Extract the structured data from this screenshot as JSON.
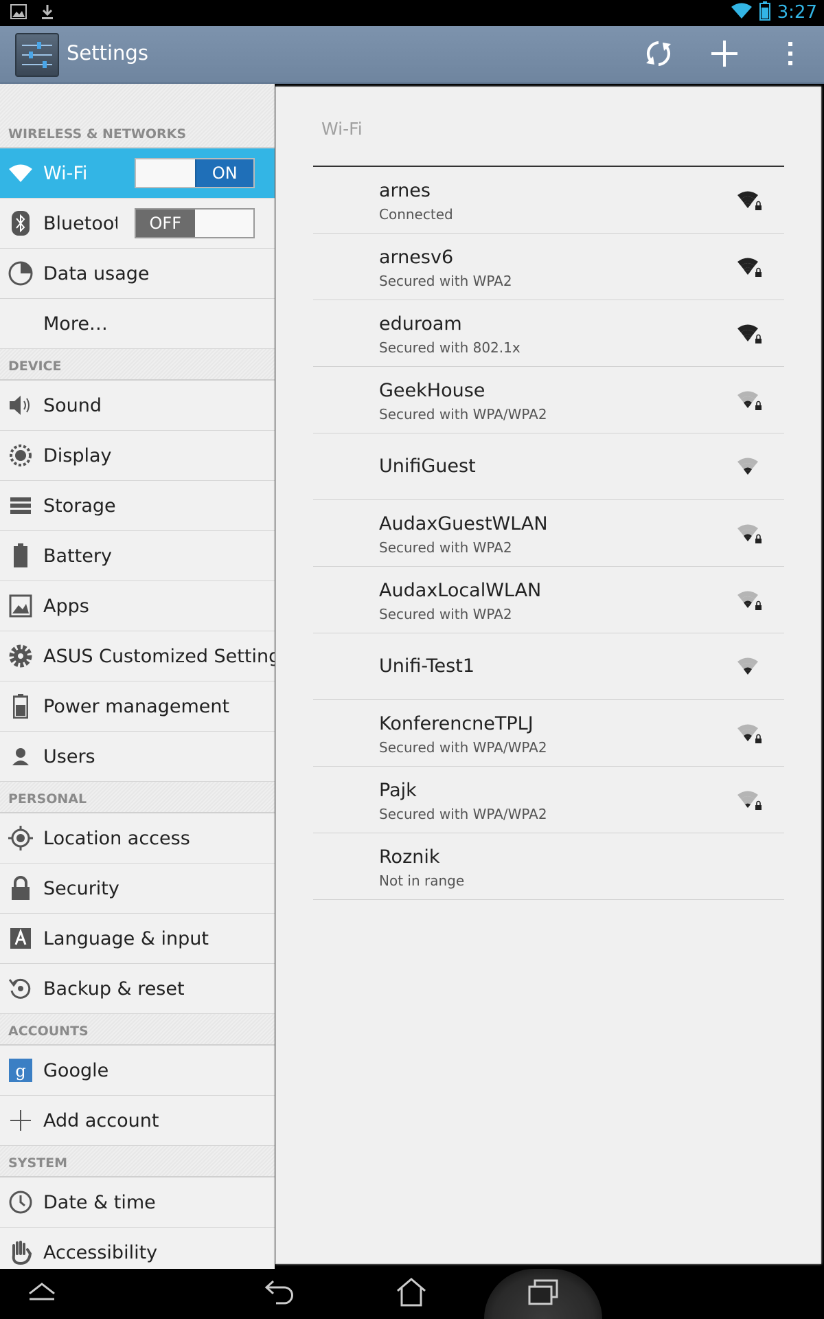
{
  "status_bar": {
    "time": "3:27",
    "left_icons": [
      "gallery-notification-icon",
      "download-notification-icon"
    ],
    "right_icons": [
      "wifi-status-icon",
      "battery-icon"
    ],
    "accent_color": "#33b5e5"
  },
  "action_bar": {
    "title": "Settings",
    "buttons": [
      "refresh-wifi-icon",
      "add-network-icon",
      "overflow-menu-icon"
    ]
  },
  "sidebar": {
    "sections": [
      {
        "header": "WIRELESS & NETWORKS",
        "items": [
          {
            "label": "Wi-Fi",
            "icon": "wifi-icon",
            "toggle": "ON",
            "active": true
          },
          {
            "label": "Bluetooth",
            "icon": "bluetooth-icon",
            "toggle": "OFF"
          },
          {
            "label": "Data usage",
            "icon": "data-usage-icon"
          },
          {
            "label": "More…",
            "icon": ""
          }
        ]
      },
      {
        "header": "DEVICE",
        "items": [
          {
            "label": "Sound",
            "icon": "speaker-icon"
          },
          {
            "label": "Display",
            "icon": "brightness-icon"
          },
          {
            "label": "Storage",
            "icon": "storage-icon"
          },
          {
            "label": "Battery",
            "icon": "battery-icon"
          },
          {
            "label": "Apps",
            "icon": "apps-icon"
          },
          {
            "label": "ASUS Customized Setting",
            "icon": "gear-icon"
          },
          {
            "label": "Power management",
            "icon": "power-management-icon"
          },
          {
            "label": "Users",
            "icon": "user-icon"
          }
        ]
      },
      {
        "header": "PERSONAL",
        "items": [
          {
            "label": "Location access",
            "icon": "location-icon"
          },
          {
            "label": "Security",
            "icon": "lock-icon"
          },
          {
            "label": "Language & input",
            "icon": "language-icon"
          },
          {
            "label": "Backup & reset",
            "icon": "backup-icon"
          }
        ]
      },
      {
        "header": "ACCOUNTS",
        "items": [
          {
            "label": "Google",
            "icon": "google-icon"
          },
          {
            "label": "Add account",
            "icon": "plus-icon"
          }
        ]
      },
      {
        "header": "SYSTEM",
        "items": [
          {
            "label": "Date & time",
            "icon": "clock-icon"
          },
          {
            "label": "Accessibility",
            "icon": "hand-icon"
          }
        ]
      }
    ]
  },
  "detail": {
    "title": "Wi-Fi",
    "networks": [
      {
        "name": "arnes",
        "status": "Connected",
        "signal": 4,
        "secured": true
      },
      {
        "name": "arnesv6",
        "status": "Secured with WPA2",
        "signal": 4,
        "secured": true
      },
      {
        "name": "eduroam",
        "status": "Secured with 802.1x",
        "signal": 4,
        "secured": true
      },
      {
        "name": "GeekHouse",
        "status": "Secured with WPA/WPA2",
        "signal": 2,
        "secured": true
      },
      {
        "name": "UnifiGuest",
        "status": "",
        "signal": 2,
        "secured": false
      },
      {
        "name": "AudaxGuestWLAN",
        "status": "Secured with WPA2",
        "signal": 2,
        "secured": true
      },
      {
        "name": "AudaxLocalWLAN",
        "status": "Secured with WPA2",
        "signal": 2,
        "secured": true
      },
      {
        "name": "Unifi-Test1",
        "status": "",
        "signal": 2,
        "secured": false
      },
      {
        "name": "KonferencneTPLJ",
        "status": "Secured with WPA/WPA2",
        "signal": 2,
        "secured": true
      },
      {
        "name": "Pajk",
        "status": "Secured with WPA/WPA2",
        "signal": 1,
        "secured": true
      },
      {
        "name": "Roznik",
        "status": "Not in range",
        "signal": 0,
        "secured": false
      }
    ]
  },
  "nav_bar": {
    "buttons": [
      "collapse-icon",
      "back-icon",
      "home-icon",
      "recent-apps-icon"
    ]
  }
}
